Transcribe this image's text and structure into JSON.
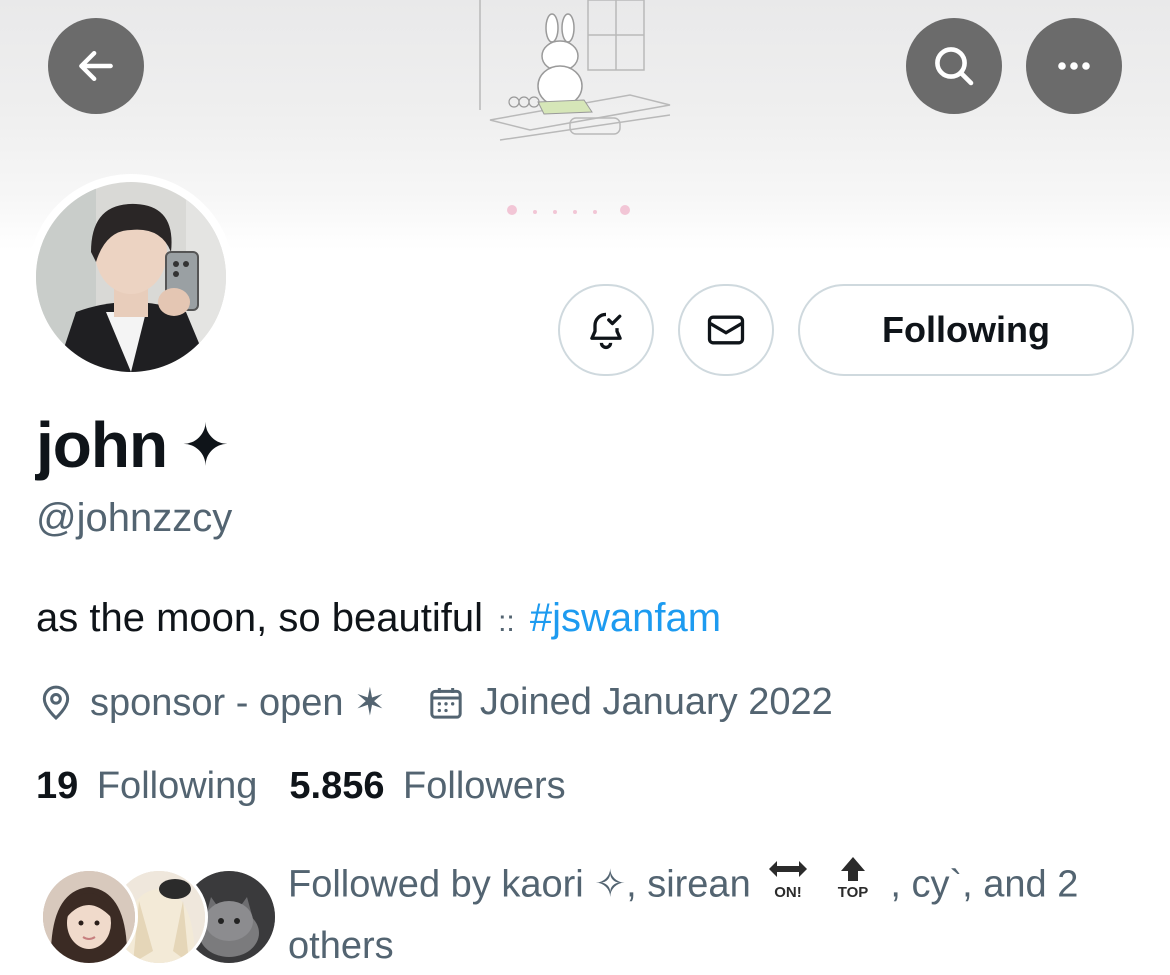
{
  "header": {
    "back_icon": "arrow-left-icon",
    "search_icon": "search-icon",
    "more_icon": "more-horizontal-icon"
  },
  "actions": {
    "notify_icon": "bell-check-icon",
    "message_icon": "envelope-icon",
    "following_label": "Following"
  },
  "profile": {
    "display_name": "john",
    "name_suffix": "✦",
    "handle": "@johnzzcy",
    "bio_text": "as the moon, so beautiful",
    "bio_sep": "::",
    "bio_hashtag": "#jswanfam",
    "location": "sponsor - open ✶",
    "joined": "Joined January 2022",
    "following_count": "19",
    "following_label": "Following",
    "followers_count": "5.856",
    "followers_label": "Followers"
  },
  "followed_by": {
    "prefix": "Followed by kaori ✧, sirean",
    "emoji_on": "ON!",
    "emoji_top": "TOP",
    "suffix": ", cy`, and 2 others"
  },
  "colors": {
    "link": "#1d9bf0",
    "secondary_text": "#536471",
    "primary_text": "#0f1419",
    "border": "#cfd9de"
  }
}
